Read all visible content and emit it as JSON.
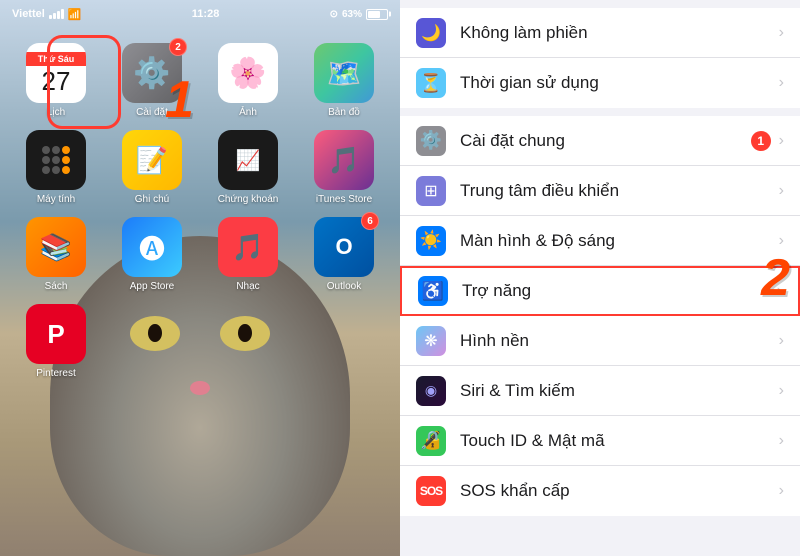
{
  "status_bar": {
    "carrier": "Viettel",
    "time": "11:28",
    "battery_percent": "63%"
  },
  "phone": {
    "day_label": "Thứ Sáu",
    "date_number": "27",
    "apps": [
      {
        "id": "lich",
        "label": "Lịch",
        "type": "calendar"
      },
      {
        "id": "caidat",
        "label": "Cài đặt",
        "type": "settings",
        "badge": "2",
        "highlighted": true
      },
      {
        "id": "photos",
        "label": "Ảnh",
        "type": "photos"
      },
      {
        "id": "bandо",
        "label": "Bản đồ",
        "type": "maps"
      },
      {
        "id": "maytinh",
        "label": "Máy tính",
        "type": "calculator"
      },
      {
        "id": "ghichu",
        "label": "Ghi chú",
        "type": "notes"
      },
      {
        "id": "chungkhoan",
        "label": "Chứng khoán",
        "type": "stocks"
      },
      {
        "id": "itunes",
        "label": "iTunes Store",
        "type": "itunes"
      },
      {
        "id": "sach",
        "label": "Sách",
        "type": "books"
      },
      {
        "id": "appstore",
        "label": "App Store",
        "type": "appstore"
      },
      {
        "id": "nhac",
        "label": "Nhạc",
        "type": "music"
      },
      {
        "id": "outlook",
        "label": "Outlook",
        "type": "outlook",
        "badge": "6"
      },
      {
        "id": "pinterest",
        "label": "Pinterest",
        "type": "pinterest"
      }
    ],
    "annotation_1": "1"
  },
  "settings": {
    "annotation_2": "2",
    "items": [
      {
        "id": "khonglam",
        "label": "Không làm phiền",
        "icon_type": "moon",
        "icon_color": "#5856d6"
      },
      {
        "id": "thoigian",
        "label": "Thời gian sử dụng",
        "icon_type": "hourglass",
        "icon_color": "#5ac8fa"
      },
      {
        "id": "caidatchung",
        "label": "Cài đặt chung",
        "icon_type": "gear",
        "icon_color": "#8e8e93",
        "badge": "1"
      },
      {
        "id": "trungtam",
        "label": "Trung tâm điều khiển",
        "icon_type": "remote",
        "icon_color": "#7b7bda"
      },
      {
        "id": "manhinh",
        "label": "Màn hình & Độ sáng",
        "icon_type": "brightness",
        "icon_color": "#007aff"
      },
      {
        "id": "tronang",
        "label": "Trợ năng",
        "icon_type": "accessibility",
        "icon_color": "#007aff",
        "highlighted": true
      },
      {
        "id": "hinhnen",
        "label": "Hình nền",
        "icon_type": "wallpaper",
        "icon_color": "#34aadc"
      },
      {
        "id": "siri",
        "label": "Siri & Tìm kiếm",
        "icon_type": "siri",
        "icon_color": "#1a1a2e"
      },
      {
        "id": "touchid",
        "label": "Touch ID & Mật mã",
        "icon_type": "touchid",
        "icon_color": "#34c759"
      },
      {
        "id": "sos",
        "label": "SOS khẩn cấp",
        "icon_type": "sos",
        "icon_color": "#ff3b30"
      }
    ]
  }
}
